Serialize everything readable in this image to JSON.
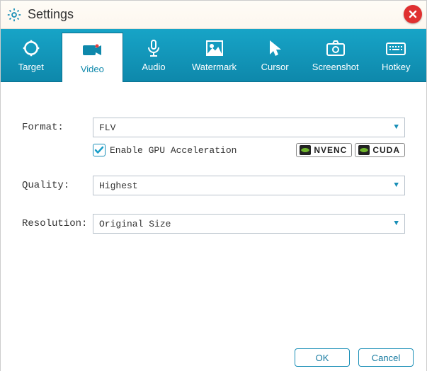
{
  "window": {
    "title": "Settings"
  },
  "tabs": [
    {
      "label": "Target"
    },
    {
      "label": "Video"
    },
    {
      "label": "Audio"
    },
    {
      "label": "Watermark"
    },
    {
      "label": "Cursor"
    },
    {
      "label": "Screenshot"
    },
    {
      "label": "Hotkey"
    }
  ],
  "active_tab": "Video",
  "fields": {
    "format": {
      "label": "Format:",
      "value": "FLV"
    },
    "quality": {
      "label": "Quality:",
      "value": "Highest"
    },
    "resolution": {
      "label": "Resolution:",
      "value": "Original Size"
    }
  },
  "gpu": {
    "checkbox_label": "Enable GPU Acceleration",
    "checked": true,
    "badges": {
      "nvenc": "NVENC",
      "cuda": "CUDA"
    }
  },
  "buttons": {
    "ok": "OK",
    "cancel": "Cancel"
  }
}
